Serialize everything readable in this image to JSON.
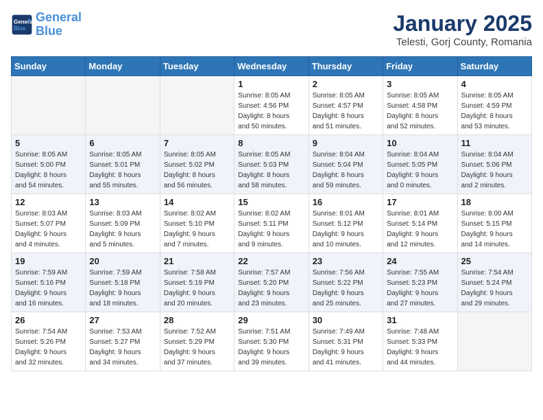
{
  "header": {
    "logo_line1": "General",
    "logo_line2": "Blue",
    "title": "January 2025",
    "subtitle": "Telesti, Gorj County, Romania"
  },
  "weekdays": [
    "Sunday",
    "Monday",
    "Tuesday",
    "Wednesday",
    "Thursday",
    "Friday",
    "Saturday"
  ],
  "weeks": [
    [
      {
        "day": "",
        "info": ""
      },
      {
        "day": "",
        "info": ""
      },
      {
        "day": "",
        "info": ""
      },
      {
        "day": "1",
        "info": "Sunrise: 8:05 AM\nSunset: 4:56 PM\nDaylight: 8 hours\nand 50 minutes."
      },
      {
        "day": "2",
        "info": "Sunrise: 8:05 AM\nSunset: 4:57 PM\nDaylight: 8 hours\nand 51 minutes."
      },
      {
        "day": "3",
        "info": "Sunrise: 8:05 AM\nSunset: 4:58 PM\nDaylight: 8 hours\nand 52 minutes."
      },
      {
        "day": "4",
        "info": "Sunrise: 8:05 AM\nSunset: 4:59 PM\nDaylight: 8 hours\nand 53 minutes."
      }
    ],
    [
      {
        "day": "5",
        "info": "Sunrise: 8:05 AM\nSunset: 5:00 PM\nDaylight: 8 hours\nand 54 minutes."
      },
      {
        "day": "6",
        "info": "Sunrise: 8:05 AM\nSunset: 5:01 PM\nDaylight: 8 hours\nand 55 minutes."
      },
      {
        "day": "7",
        "info": "Sunrise: 8:05 AM\nSunset: 5:02 PM\nDaylight: 8 hours\nand 56 minutes."
      },
      {
        "day": "8",
        "info": "Sunrise: 8:05 AM\nSunset: 5:03 PM\nDaylight: 8 hours\nand 58 minutes."
      },
      {
        "day": "9",
        "info": "Sunrise: 8:04 AM\nSunset: 5:04 PM\nDaylight: 8 hours\nand 59 minutes."
      },
      {
        "day": "10",
        "info": "Sunrise: 8:04 AM\nSunset: 5:05 PM\nDaylight: 9 hours\nand 0 minutes."
      },
      {
        "day": "11",
        "info": "Sunrise: 8:04 AM\nSunset: 5:06 PM\nDaylight: 9 hours\nand 2 minutes."
      }
    ],
    [
      {
        "day": "12",
        "info": "Sunrise: 8:03 AM\nSunset: 5:07 PM\nDaylight: 9 hours\nand 4 minutes."
      },
      {
        "day": "13",
        "info": "Sunrise: 8:03 AM\nSunset: 5:09 PM\nDaylight: 9 hours\nand 5 minutes."
      },
      {
        "day": "14",
        "info": "Sunrise: 8:02 AM\nSunset: 5:10 PM\nDaylight: 9 hours\nand 7 minutes."
      },
      {
        "day": "15",
        "info": "Sunrise: 8:02 AM\nSunset: 5:11 PM\nDaylight: 9 hours\nand 9 minutes."
      },
      {
        "day": "16",
        "info": "Sunrise: 8:01 AM\nSunset: 5:12 PM\nDaylight: 9 hours\nand 10 minutes."
      },
      {
        "day": "17",
        "info": "Sunrise: 8:01 AM\nSunset: 5:14 PM\nDaylight: 9 hours\nand 12 minutes."
      },
      {
        "day": "18",
        "info": "Sunrise: 8:00 AM\nSunset: 5:15 PM\nDaylight: 9 hours\nand 14 minutes."
      }
    ],
    [
      {
        "day": "19",
        "info": "Sunrise: 7:59 AM\nSunset: 5:16 PM\nDaylight: 9 hours\nand 16 minutes."
      },
      {
        "day": "20",
        "info": "Sunrise: 7:59 AM\nSunset: 5:18 PM\nDaylight: 9 hours\nand 18 minutes."
      },
      {
        "day": "21",
        "info": "Sunrise: 7:58 AM\nSunset: 5:19 PM\nDaylight: 9 hours\nand 20 minutes."
      },
      {
        "day": "22",
        "info": "Sunrise: 7:57 AM\nSunset: 5:20 PM\nDaylight: 9 hours\nand 23 minutes."
      },
      {
        "day": "23",
        "info": "Sunrise: 7:56 AM\nSunset: 5:22 PM\nDaylight: 9 hours\nand 25 minutes."
      },
      {
        "day": "24",
        "info": "Sunrise: 7:55 AM\nSunset: 5:23 PM\nDaylight: 9 hours\nand 27 minutes."
      },
      {
        "day": "25",
        "info": "Sunrise: 7:54 AM\nSunset: 5:24 PM\nDaylight: 9 hours\nand 29 minutes."
      }
    ],
    [
      {
        "day": "26",
        "info": "Sunrise: 7:54 AM\nSunset: 5:26 PM\nDaylight: 9 hours\nand 32 minutes."
      },
      {
        "day": "27",
        "info": "Sunrise: 7:53 AM\nSunset: 5:27 PM\nDaylight: 9 hours\nand 34 minutes."
      },
      {
        "day": "28",
        "info": "Sunrise: 7:52 AM\nSunset: 5:29 PM\nDaylight: 9 hours\nand 37 minutes."
      },
      {
        "day": "29",
        "info": "Sunrise: 7:51 AM\nSunset: 5:30 PM\nDaylight: 9 hours\nand 39 minutes."
      },
      {
        "day": "30",
        "info": "Sunrise: 7:49 AM\nSunset: 5:31 PM\nDaylight: 9 hours\nand 41 minutes."
      },
      {
        "day": "31",
        "info": "Sunrise: 7:48 AM\nSunset: 5:33 PM\nDaylight: 9 hours\nand 44 minutes."
      },
      {
        "day": "",
        "info": ""
      }
    ]
  ]
}
